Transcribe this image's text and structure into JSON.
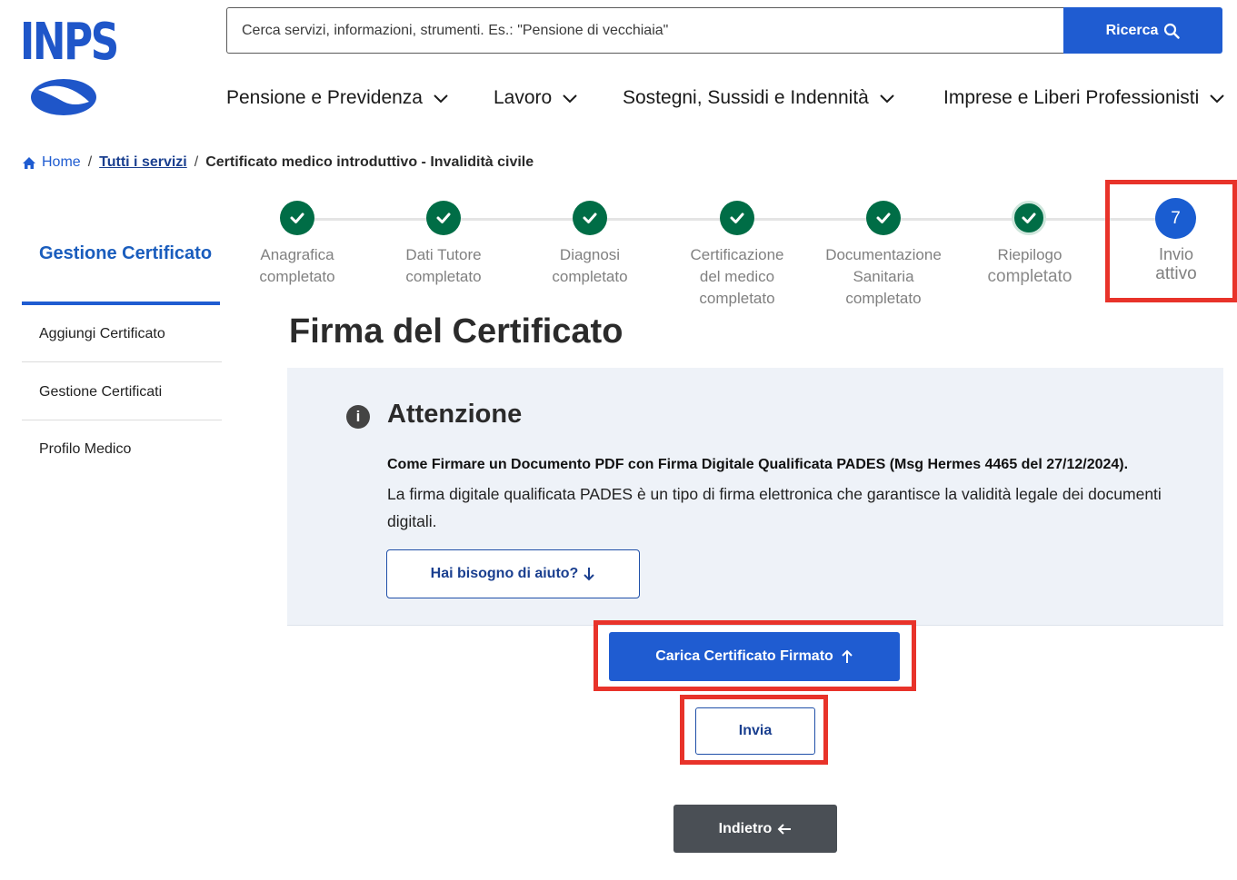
{
  "brand": {
    "logo_text": "INPS",
    "primary_color": "#1f5cd1",
    "success_color": "#006d46",
    "highlight_color": "#e8332a"
  },
  "search": {
    "placeholder": "Cerca servizi, informazioni, strumenti. Es.: \"Pensione di vecchiaia\"",
    "button_label": "Ricerca"
  },
  "nav": {
    "items": [
      {
        "label": "Pensione e Previdenza"
      },
      {
        "label": "Lavoro"
      },
      {
        "label": "Sostegni, Sussidi e Indennità"
      },
      {
        "label": "Imprese e Liberi Professionisti"
      }
    ]
  },
  "breadcrumb": {
    "home": "Home",
    "sep": "/",
    "services": "Tutti i servizi",
    "current": "Certificato medico introduttivo - Invalidità civile"
  },
  "sidebar": {
    "title": "Gestione Certificato",
    "items": [
      {
        "label": "Aggiungi Certificato"
      },
      {
        "label": "Gestione Certificati"
      },
      {
        "label": "Profilo Medico"
      }
    ]
  },
  "stepper": {
    "steps": [
      {
        "line1": "Anagrafica",
        "line2": "completato",
        "line3": "",
        "status": "done"
      },
      {
        "line1": "Dati Tutore",
        "line2": "completato",
        "line3": "",
        "status": "done"
      },
      {
        "line1": "Diagnosi",
        "line2": "completato",
        "line3": "",
        "status": "done"
      },
      {
        "line1": "Certificazione",
        "line2": "del medico",
        "line3": "completato",
        "status": "done"
      },
      {
        "line1": "Documentazione",
        "line2": "Sanitaria",
        "line3": "completato",
        "status": "done"
      },
      {
        "line1": "Riepilogo",
        "line2": "completato",
        "line3": "",
        "status": "done"
      },
      {
        "number": "7",
        "line1": "Invio",
        "line2": "attivo",
        "line3": "",
        "status": "active"
      }
    ]
  },
  "main": {
    "title": "Firma del Certificato",
    "alert": {
      "title": "Attenzione",
      "bold_text": "Come Firmare un Documento PDF con Firma Digitale Qualificata PADES (Msg Hermes 4465 del 27/12/2024).",
      "text": "La firma digitale qualificata PADES è un tipo di firma elettronica che garantisce la validità legale dei documenti digitali.",
      "help_button": "Hai bisogno di aiuto?"
    },
    "upload_button": "Carica Certificato Firmato",
    "send_button": "Invia",
    "back_button": "Indietro"
  }
}
